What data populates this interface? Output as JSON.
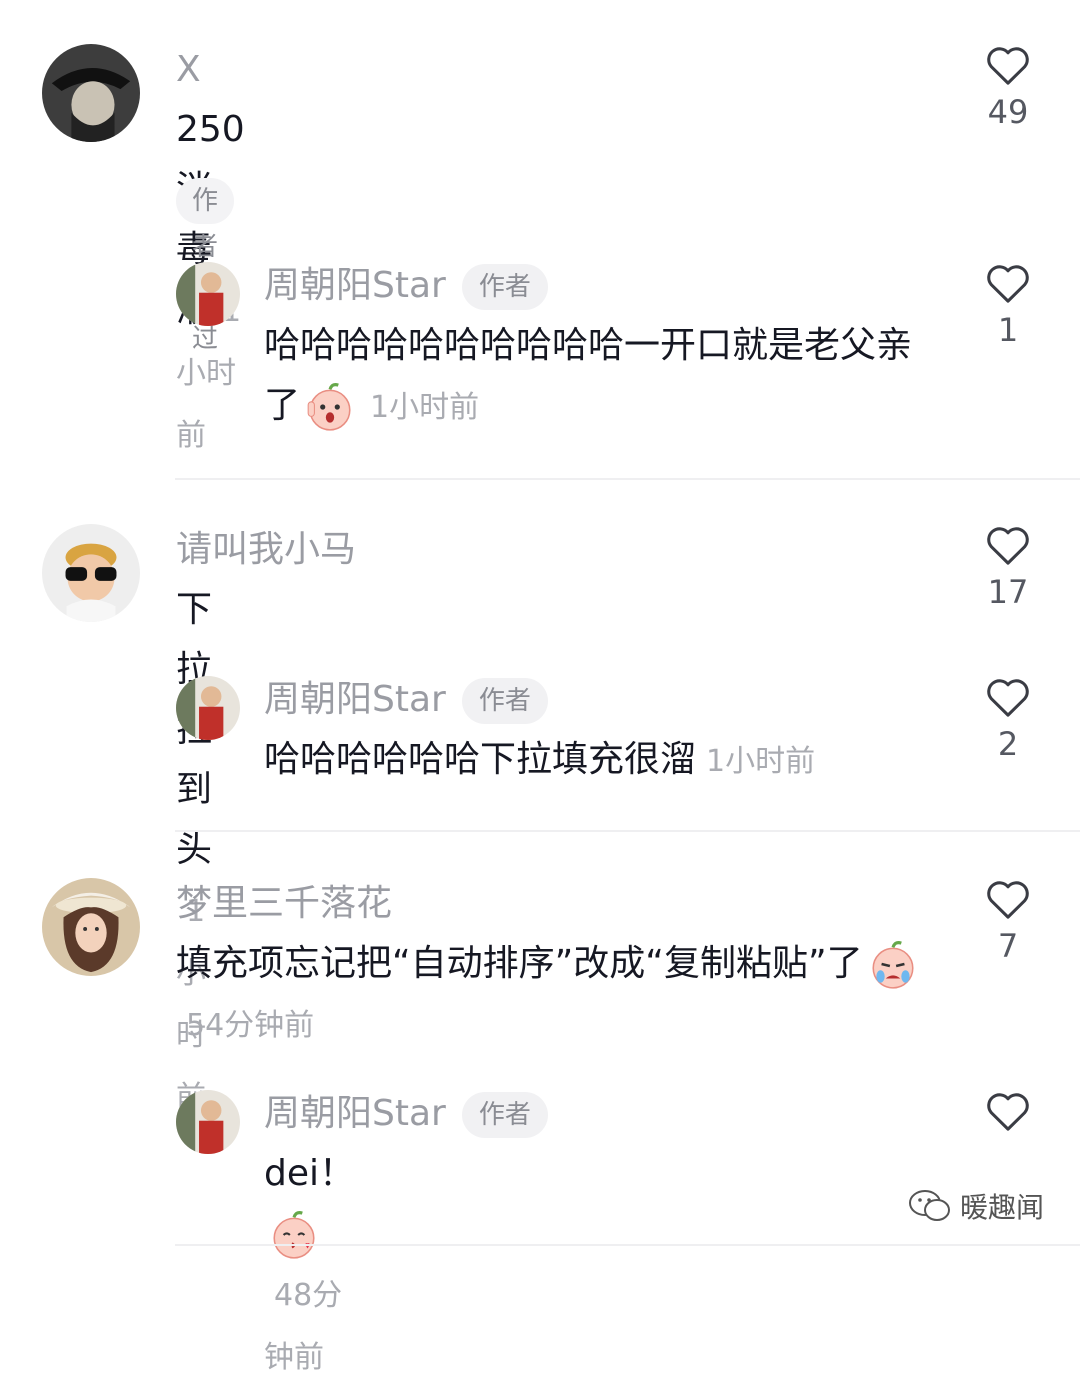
{
  "comments": [
    {
      "username": "X",
      "text": "250 消毒液",
      "time": "1小时前",
      "likes": "49",
      "badge": "作者赞过",
      "reply": {
        "username": "周朝阳Star",
        "author_tag": "作者",
        "text": "哈哈哈哈哈哈哈哈哈哈一开口就是老父亲了",
        "emoji": "shocked-peach-emoji",
        "time": "1小时前",
        "likes": "1"
      }
    },
    {
      "username": "请叫我小马",
      "text": "下拉拉到头",
      "time": "1小时前",
      "likes": "17",
      "reply": {
        "username": "周朝阳Star",
        "author_tag": "作者",
        "text": "哈哈哈哈哈哈下拉填充很溜",
        "time": "1小时前",
        "likes": "2"
      }
    },
    {
      "username": "梦里三千落花",
      "text": "填充项忘记把“自动排序”改成“复制粘贴”了",
      "emoji": "crying-peach-emoji",
      "time": "54分钟前",
      "likes": "7",
      "reply": {
        "username": "周朝阳Star",
        "author_tag": "作者",
        "text": "dei！",
        "emoji": "kiss-peach-emoji",
        "time": "48分钟前",
        "likes": ""
      }
    }
  ],
  "watermark": "暖趣闻",
  "colors": {
    "username": "#9a9ca3",
    "text": "#161823",
    "time": "#a9abb1"
  }
}
